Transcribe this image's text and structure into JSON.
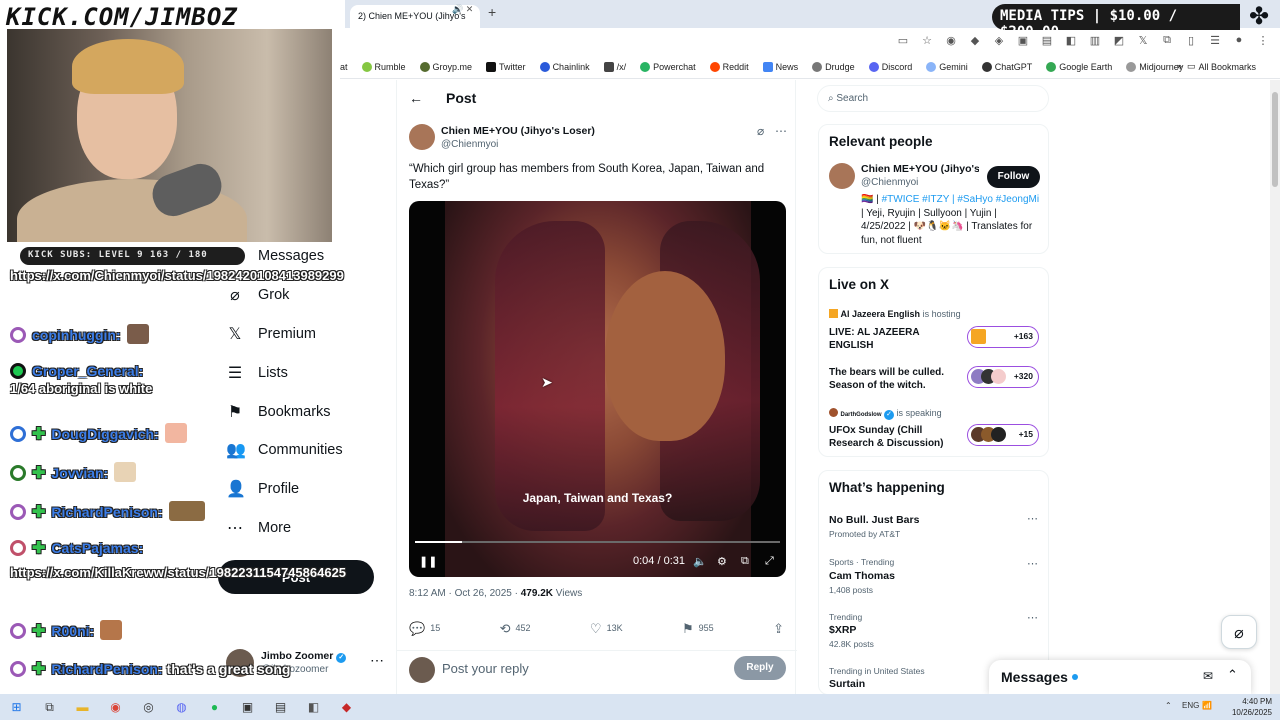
{
  "overlay": {
    "banner": "KICK.COM/JIMBOZ",
    "tips": "MEDIA TIPS | $10.00 / $200.00",
    "kick_subs": "KICK SUBS: LEVEL 9 163 / 180",
    "chat": [
      {
        "name": "",
        "text": "https://x.com/Chienmyoi/status/1982420108413989299"
      },
      {
        "name": "copinhuggin:",
        "text": ""
      },
      {
        "name": "Groper_General:",
        "text": "1/64 aboriginal is white"
      },
      {
        "name": "DougDiggavich:",
        "text": ""
      },
      {
        "name": "Jovvian:",
        "text": ""
      },
      {
        "name": "RichardPenison:",
        "text": ""
      },
      {
        "name": "CatsPajamas:",
        "text": "https://x.com/KillaKreww/status/1982231154745864625"
      },
      {
        "name": "R00ni:",
        "text": ""
      },
      {
        "name": "RichardPenison:",
        "text": "that's a great song"
      }
    ]
  },
  "browser": {
    "tab_title": "2) Chien ME+YOU (Jihyo's",
    "bookmarks": [
      "at",
      "Rumble",
      "Groyp.me",
      "Twitter",
      "Chainlink",
      "/x/",
      "Powerchat",
      "Reddit",
      "News",
      "Drudge",
      "Discord",
      "Gemini",
      "ChatGPT",
      "Google Earth",
      "Midjourney"
    ],
    "all_bookmarks": "All Bookmarks"
  },
  "nav": {
    "items": [
      {
        "icon": "✉",
        "label": "Messages"
      },
      {
        "icon": "⌀",
        "label": "Grok"
      },
      {
        "icon": "𝕏",
        "label": "Premium"
      },
      {
        "icon": "☰",
        "label": "Lists"
      },
      {
        "icon": "⚑",
        "label": "Bookmarks"
      },
      {
        "icon": "👥",
        "label": "Communities"
      },
      {
        "icon": "👤",
        "label": "Profile"
      },
      {
        "icon": "⋯",
        "label": "More"
      }
    ],
    "post_button": "Post",
    "account": {
      "name": "Jimbo Zoomer",
      "handle": "@jimbozoomer",
      "more": "⋯"
    }
  },
  "post": {
    "header": "Post",
    "author_name": "Chien ME+YOU (Jihyo's Loser)",
    "author_handle": "@Chienmyoi",
    "text": "“Which girl group has members from South Korea, Japan, Taiwan and Texas?”",
    "video_caption": "Japan, Taiwan and Texas?",
    "video_time": "0:04 / 0:31",
    "video_progress": 0.13,
    "timestamp": "8:12 AM · Oct 26, 2025 · ",
    "views_count": "479.2K",
    "views_label": " Views",
    "replies": "15",
    "reposts": "452",
    "likes": "13K",
    "bookmarks": "955",
    "reply_placeholder": "Post your reply",
    "reply_button": "Reply"
  },
  "sidebar": {
    "search_placeholder": "Search",
    "relevant_title": "Relevant people",
    "person_name": "Chien ME+YOU (Jihyo's...",
    "person_handle": "@Chienmyoi",
    "follow": "Follow",
    "bio_1": "🏳️‍🌈 | ",
    "bio_tags": "#TWICE #ITZY | #SaHyo #JeongMi",
    "bio_2": " | Yeji, Ryujin | Sullyoon | Yujin | 4/25/2022 | 🐶🐧🐱🦄 | Translates for fun, not fluent",
    "live_title": "Live on X",
    "live": [
      {
        "host": "Al Jazeera English",
        "status": "is hosting",
        "title": "LIVE: AL JAZEERA ENGLISH",
        "count": "+163"
      },
      {
        "host": "",
        "status": "",
        "title": "The bears will be culled. Season of the witch.",
        "count": "+320"
      },
      {
        "host": "DarthGodslow",
        "status": "is speaking",
        "title": "UFOx Sunday (Chill Research & Discussion)",
        "count": "+15"
      }
    ],
    "happening_title": "What’s happening",
    "trends": [
      {
        "cat": "",
        "name": "No Bull. Just Bars",
        "posts": "Promoted by AT&T"
      },
      {
        "cat": "Sports · Trending",
        "name": "Cam Thomas",
        "posts": "1,408 posts"
      },
      {
        "cat": "Trending",
        "name": "$XRP",
        "posts": "42.8K posts"
      },
      {
        "cat": "Trending in United States",
        "name": "Surtain",
        "posts": ""
      }
    ],
    "messages": "Messages"
  },
  "taskbar": {
    "lang": "ENG",
    "time": "4:40 PM",
    "date": "10/26/2025"
  },
  "colors": {
    "accent": "#1d9bf0",
    "chat_name": "#3b7de8",
    "live_ring": "#9b4ee0"
  }
}
